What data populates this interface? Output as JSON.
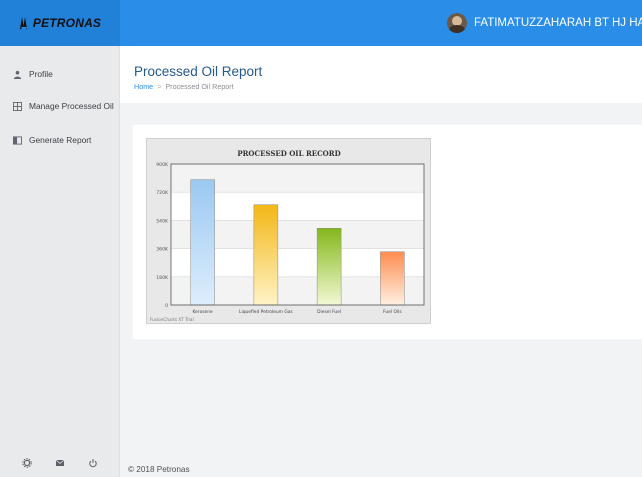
{
  "brand": {
    "name": "PETRONAS"
  },
  "user": {
    "name": "FATIMATUZZAHARAH BT HJ HASHIM"
  },
  "sidebar": {
    "items": [
      {
        "label": "Profile",
        "icon": "user-icon"
      },
      {
        "label": "Manage Processed Oil",
        "icon": "table-icon"
      },
      {
        "label": "Generate Report",
        "icon": "report-icon"
      }
    ],
    "footer_icons": [
      "settings-icon",
      "mail-icon",
      "power-icon"
    ]
  },
  "page": {
    "title": "Processed Oil Report",
    "breadcrumb": {
      "home": "Home",
      "separator": ">",
      "current": "Processed Oil Report"
    }
  },
  "chart_data": {
    "type": "bar",
    "title": "PROCESSED OIL RECORD",
    "categories": [
      "Kerosene",
      "Liquefied Petroleum Gas",
      "Diesel Fuel",
      "Fuel Oils"
    ],
    "values": [
      800000,
      640000,
      490000,
      340000
    ],
    "yticks": [
      "0",
      "180K",
      "360K",
      "540K",
      "720K",
      "900K"
    ],
    "ylim": [
      0,
      900000
    ],
    "grid": true,
    "bar_colors": [
      [
        "#ddeefc",
        "#9bc8f1"
      ],
      [
        "#fff3c7",
        "#f3b716"
      ],
      [
        "#f2f9d5",
        "#84b71a"
      ],
      [
        "#fff0e3",
        "#fe8c4f"
      ]
    ],
    "watermark": "FusionCharts XT Trial"
  },
  "footer": {
    "text": "© 2018 Petronas"
  },
  "colors": {
    "topbar": "#2a8ee8",
    "brand_bg": "#2180d8",
    "title": "#245b8f",
    "link": "#2a8ee8"
  }
}
